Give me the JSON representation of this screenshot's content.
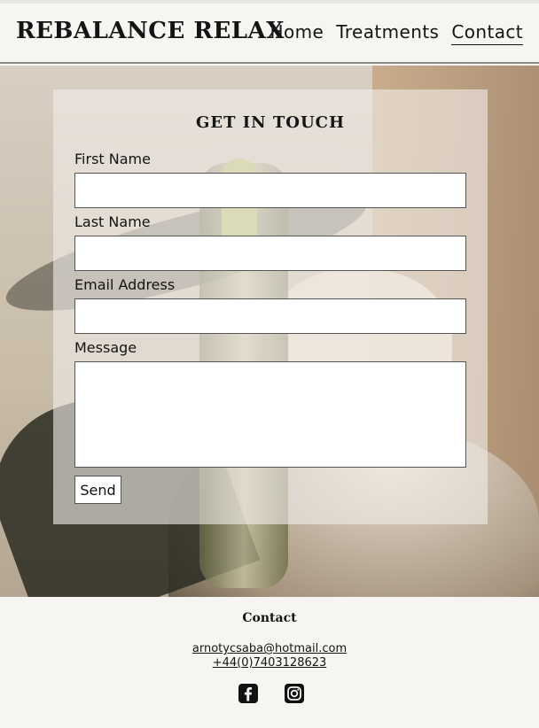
{
  "header": {
    "brand": "REBALANCE RELAX",
    "nav": [
      {
        "label": "Home",
        "active": false
      },
      {
        "label": "Treatments",
        "active": false
      },
      {
        "label": "Contact",
        "active": true
      }
    ]
  },
  "form": {
    "title": "GET IN TOUCH",
    "fields": [
      {
        "label": "First Name",
        "value": "",
        "placeholder": ""
      },
      {
        "label": "Last Name",
        "value": "",
        "placeholder": ""
      },
      {
        "label": "Email Address",
        "value": "",
        "placeholder": ""
      },
      {
        "label": "Message",
        "value": "",
        "placeholder": ""
      }
    ],
    "submit_label": "Send"
  },
  "footer": {
    "title": "Contact",
    "email": "arnotycsaba@hotmail.com",
    "phone": "+44(0)7403128623",
    "icons": [
      "facebook-icon",
      "instagram-icon"
    ]
  }
}
